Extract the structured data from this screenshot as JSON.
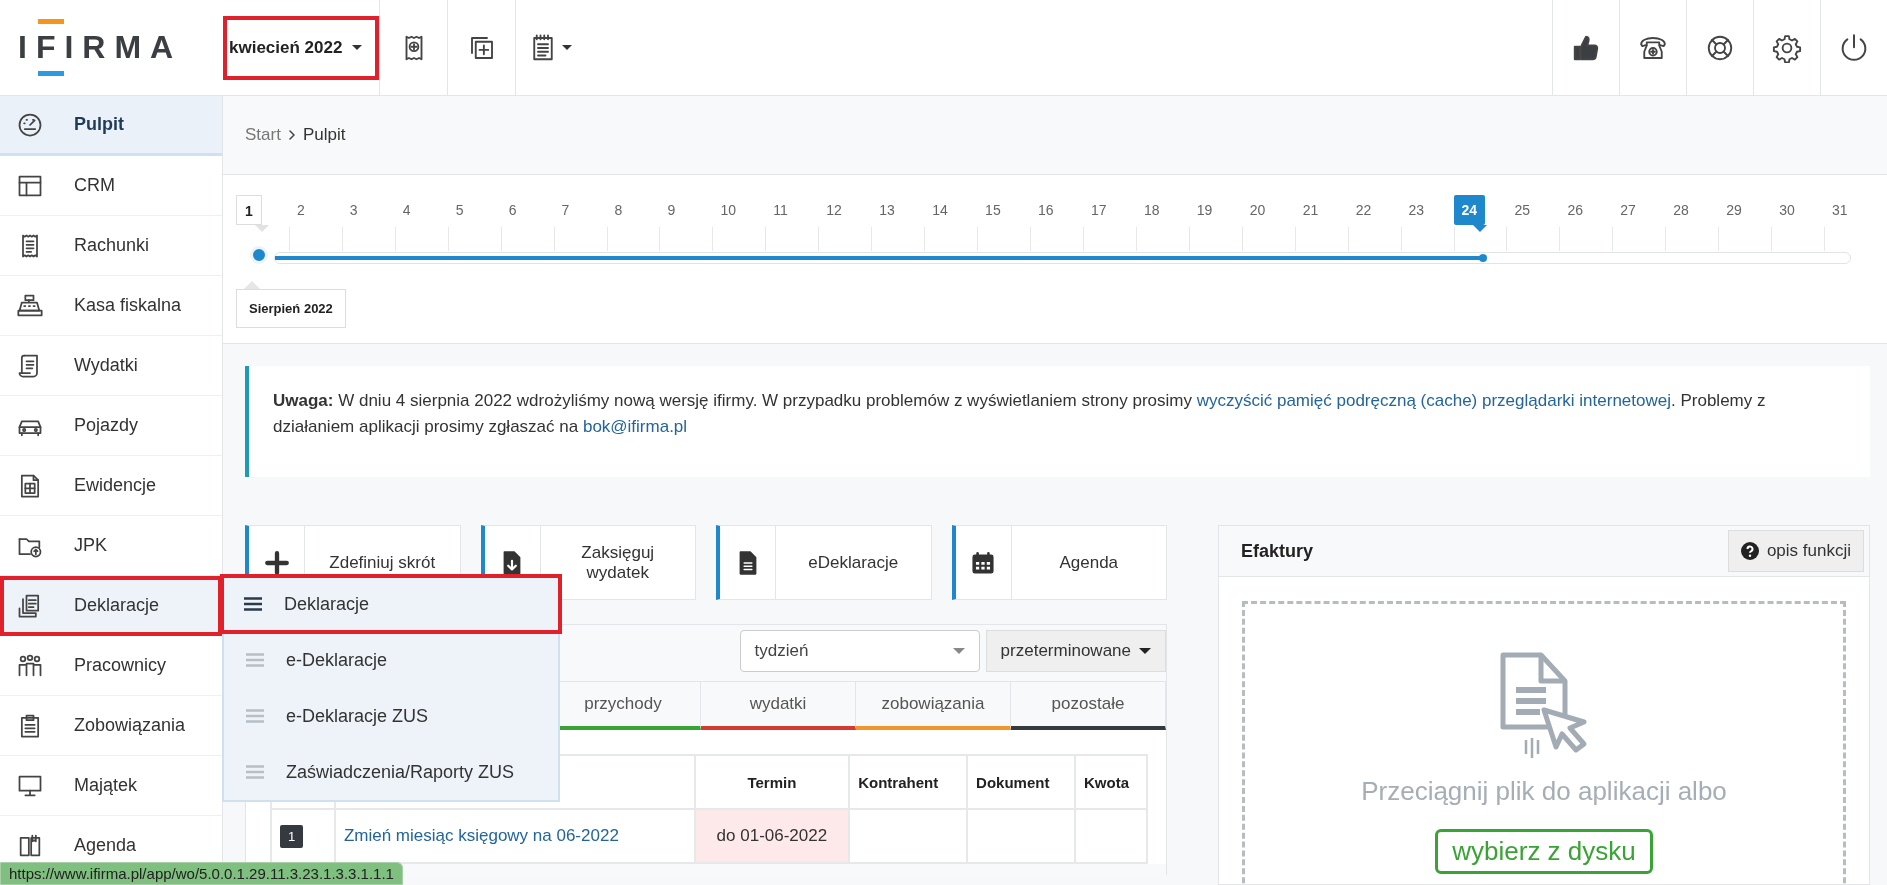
{
  "topbar": {
    "logo": "IFIRMA",
    "period": {
      "label": "kwiecień 2022",
      "highlighted": true
    }
  },
  "sidebar": {
    "items": [
      {
        "label": "Pulpit",
        "selected": true,
        "expanded": false,
        "highlighted": false
      },
      {
        "label": "CRM",
        "selected": false,
        "expanded": false,
        "highlighted": false
      },
      {
        "label": "Rachunki",
        "selected": false,
        "expanded": false,
        "highlighted": false
      },
      {
        "label": "Kasa fiskalna",
        "selected": false,
        "expanded": false,
        "highlighted": false
      },
      {
        "label": "Wydatki",
        "selected": false,
        "expanded": false,
        "highlighted": false
      },
      {
        "label": "Pojazdy",
        "selected": false,
        "expanded": false,
        "highlighted": false
      },
      {
        "label": "Ewidencje",
        "selected": false,
        "expanded": false,
        "highlighted": false
      },
      {
        "label": "JPK",
        "selected": false,
        "expanded": false,
        "highlighted": false
      },
      {
        "label": "Deklaracje",
        "selected": false,
        "expanded": true,
        "highlighted": true,
        "submenu": [
          {
            "label": "Deklaracje",
            "highlighted": true
          },
          {
            "label": "e-Deklaracje",
            "highlighted": false
          },
          {
            "label": "e-Deklaracje ZUS",
            "highlighted": false
          },
          {
            "label": "Zaświadczenia/Raporty ZUS",
            "highlighted": false
          }
        ]
      },
      {
        "label": "Pracownicy",
        "selected": false,
        "expanded": false,
        "highlighted": false
      },
      {
        "label": "Zobowiązania",
        "selected": false,
        "expanded": false,
        "highlighted": false
      },
      {
        "label": "Majątek",
        "selected": false,
        "expanded": false,
        "highlighted": false
      },
      {
        "label": "Agenda",
        "selected": false,
        "expanded": false,
        "highlighted": false
      }
    ]
  },
  "breadcrumb": [
    "Start",
    "Pulpit"
  ],
  "timeline": {
    "level": 0.767,
    "start_label": "Sierpień 2022",
    "days": [
      {
        "label": "1",
        "kind": "start"
      },
      {
        "label": "2",
        "kind": "day"
      },
      {
        "label": "3",
        "kind": "day"
      },
      {
        "label": "4",
        "kind": "day"
      },
      {
        "label": "5",
        "kind": "day"
      },
      {
        "label": "6",
        "kind": "day"
      },
      {
        "label": "7",
        "kind": "day"
      },
      {
        "label": "8",
        "kind": "day"
      },
      {
        "label": "9",
        "kind": "day"
      },
      {
        "label": "10",
        "kind": "day"
      },
      {
        "label": "11",
        "kind": "day"
      },
      {
        "label": "12",
        "kind": "day"
      },
      {
        "label": "13",
        "kind": "day"
      },
      {
        "label": "14",
        "kind": "day"
      },
      {
        "label": "15",
        "kind": "day"
      },
      {
        "label": "16",
        "kind": "day"
      },
      {
        "label": "17",
        "kind": "day"
      },
      {
        "label": "18",
        "kind": "day"
      },
      {
        "label": "19",
        "kind": "day"
      },
      {
        "label": "20",
        "kind": "day"
      },
      {
        "label": "21",
        "kind": "day"
      },
      {
        "label": "22",
        "kind": "day"
      },
      {
        "label": "23",
        "kind": "day"
      },
      {
        "label": "24",
        "kind": "current"
      },
      {
        "label": "25",
        "kind": "day"
      },
      {
        "label": "26",
        "kind": "day"
      },
      {
        "label": "27",
        "kind": "day"
      },
      {
        "label": "28",
        "kind": "day"
      },
      {
        "label": "29",
        "kind": "day"
      },
      {
        "label": "30",
        "kind": "day"
      },
      {
        "label": "31",
        "kind": "day"
      }
    ]
  },
  "notice": {
    "label": "Uwaga:",
    "text_1": "W dniu 4 sierpnia 2022 wdrożyliśmy nową wersję ifirmy. W przypadku problemów z wyświetlaniem strony prosimy",
    "link_1": "wyczyścić pamięć podręczną (cache) przeglądarki internetowej",
    "text_2": ". Problemy z działaniem aplikacji prosimy zgłaszać na",
    "link_2": "bok@ifirma.pl"
  },
  "shortcuts": [
    {
      "label": "Zdefiniuj skrót"
    },
    {
      "label": "Zaksięguj wydatek"
    },
    {
      "label": "eDeklaracje"
    },
    {
      "label": "Agenda"
    }
  ],
  "tasks": {
    "period_select": {
      "value": "tydzień"
    },
    "filter_button": "przeterminowane",
    "tabs": [
      {
        "label": "przychody",
        "color": "#3aa335"
      },
      {
        "label": "wydatki",
        "color": "#d43a2f"
      },
      {
        "label": "zobowiązania",
        "color": "#f0952f"
      },
      {
        "label": "pozostałe",
        "color": "#343a40"
      }
    ],
    "columns": [
      "Termin",
      "Kontrahent",
      "Dokument",
      "Kwota"
    ],
    "rows": [
      {
        "number": "1",
        "task": "Zmień miesiąc księgowy na 06-2022",
        "deadline": "do 01-06-2022",
        "overdue": true
      }
    ]
  },
  "efaktury": {
    "title": "Efaktury",
    "help_button": "opis funkcji",
    "drop_text": "Przeciągnij plik do aplikacji albo",
    "upload_button": "wybierz z dysku"
  },
  "status_url": "https://www.ifirma.pl/app/wo/5.0.0.1.29.11.3.23.1.3.3.1.1.1"
}
